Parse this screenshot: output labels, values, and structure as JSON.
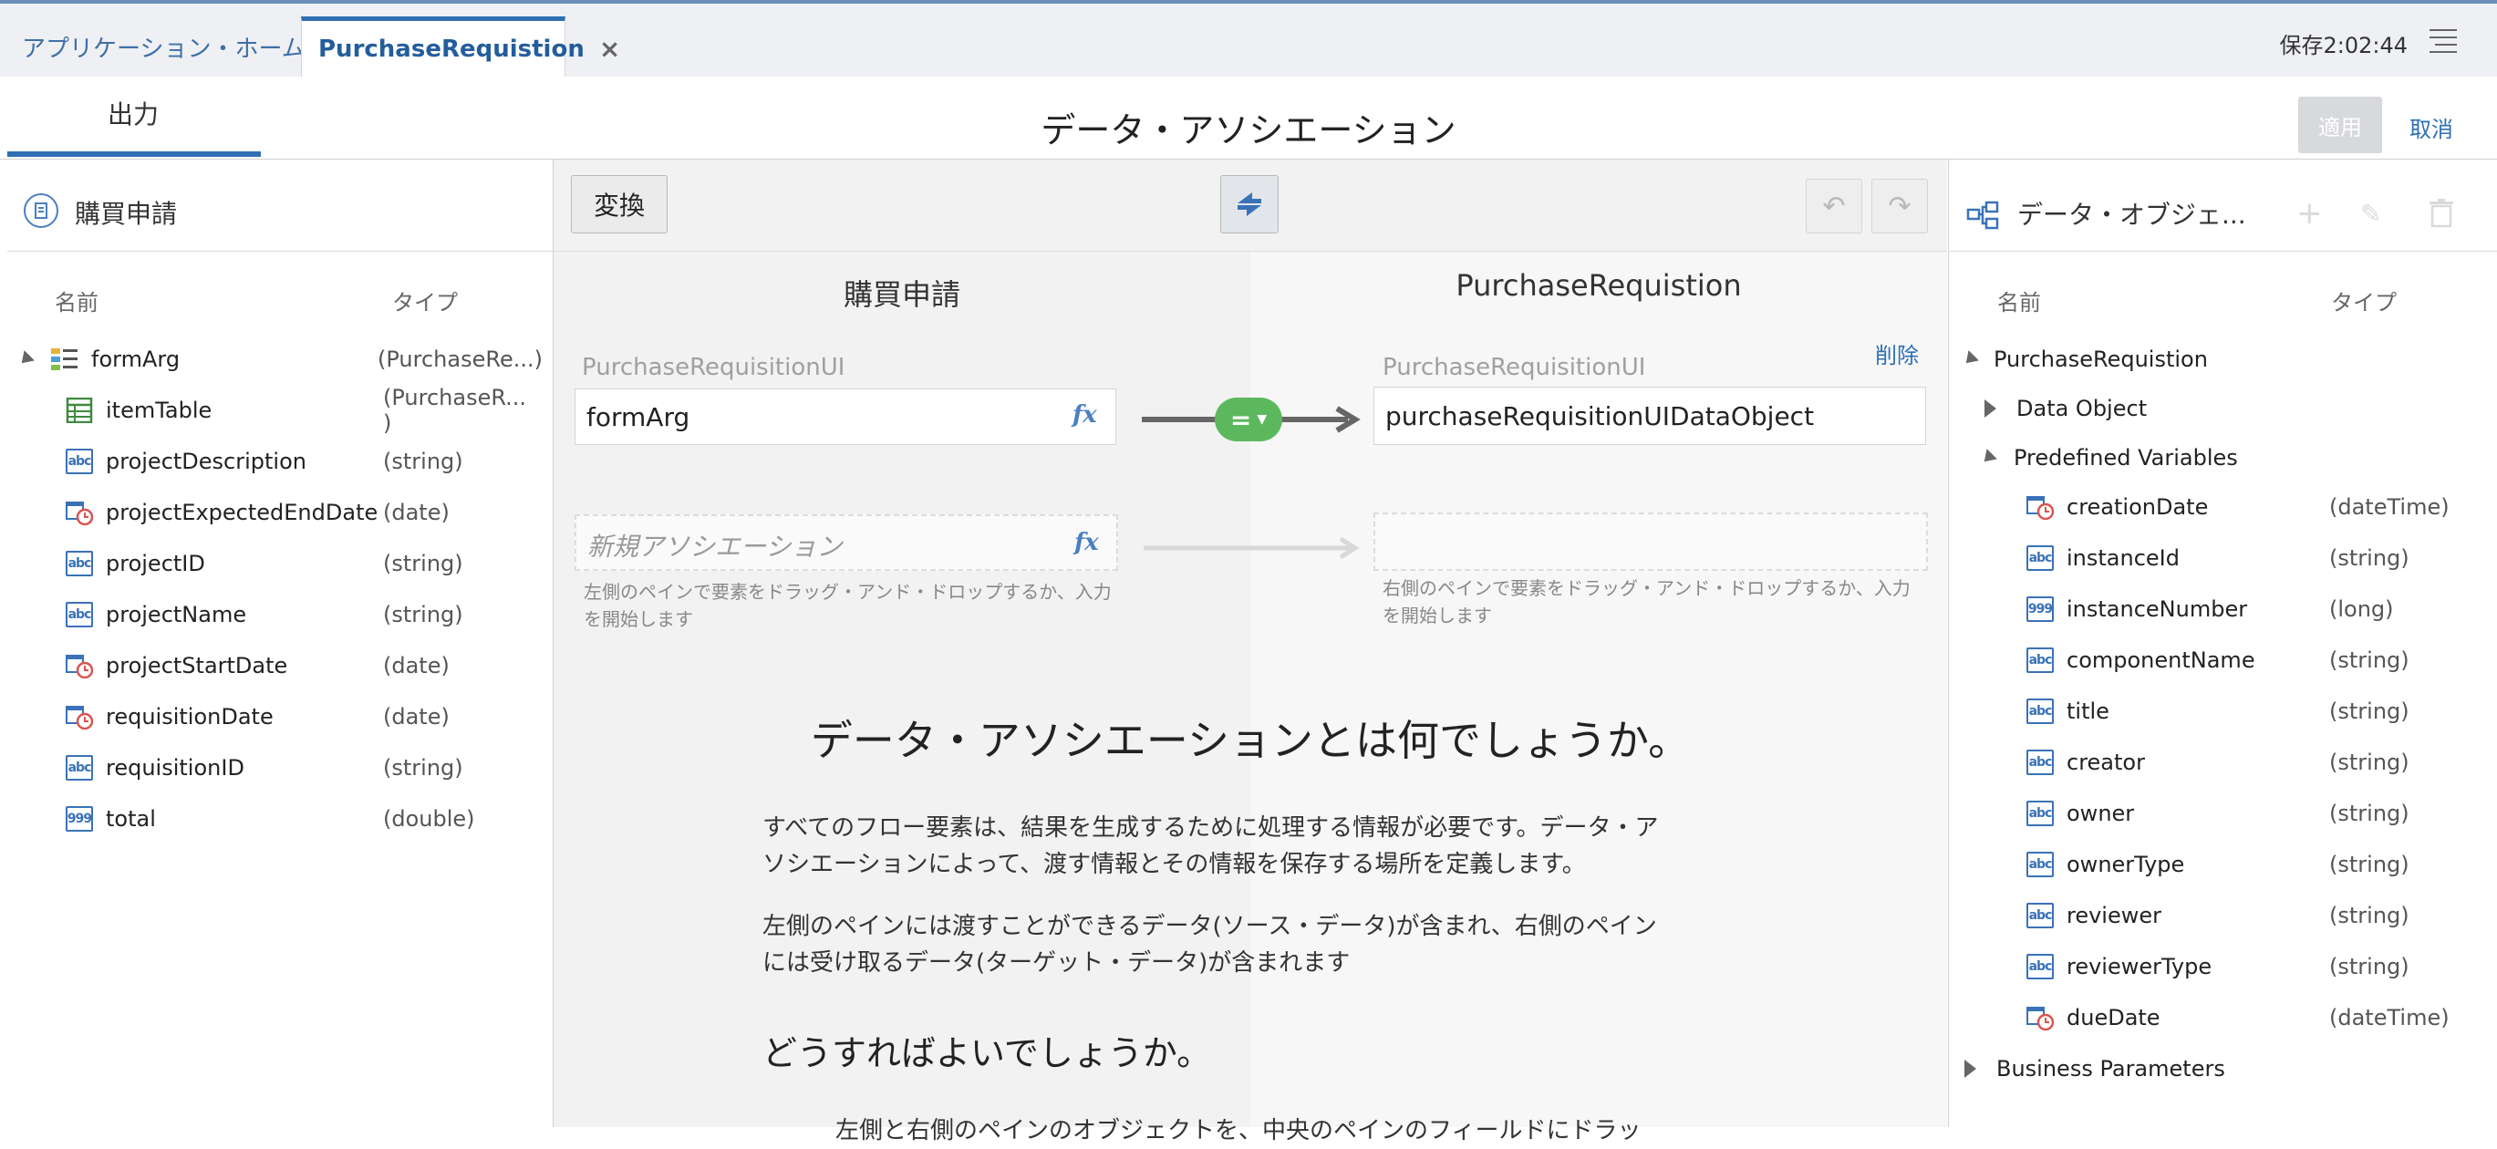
{
  "tabs": {
    "home": "アプリケーション・ホーム",
    "active": "PurchaseRequistion",
    "close": "×"
  },
  "save_status": "保存2:02:44",
  "output_tab": "出力",
  "page_title": "データ・アソシエーション",
  "buttons": {
    "apply": "適用",
    "cancel": "取消",
    "convert": "変換",
    "delete": "削除"
  },
  "left": {
    "title": "購買申請",
    "col_name": "名前",
    "col_type": "タイプ",
    "root": {
      "name": "formArg",
      "type": "(PurchaseRe...)"
    },
    "items": [
      {
        "name": "itemTable",
        "type": "(PurchaseR... )",
        "icon": "table-icon"
      },
      {
        "name": "projectDescription",
        "type": "(string)",
        "icon": "string-icon"
      },
      {
        "name": "projectExpectedEndDate",
        "type": "(date)",
        "icon": "date-icon"
      },
      {
        "name": "projectID",
        "type": "(string)",
        "icon": "string-icon"
      },
      {
        "name": "projectName",
        "type": "(string)",
        "icon": "string-icon"
      },
      {
        "name": "projectStartDate",
        "type": "(date)",
        "icon": "date-icon"
      },
      {
        "name": "requisitionDate",
        "type": "(date)",
        "icon": "date-icon"
      },
      {
        "name": "requisitionID",
        "type": "(string)",
        "icon": "string-icon"
      },
      {
        "name": "total",
        "type": "(double)",
        "icon": "number-icon"
      }
    ]
  },
  "center": {
    "source_title": "購買申請",
    "target_title": "PurchaseRequistion",
    "source_ui_label": "PurchaseRequisitionUI",
    "target_ui_label": "PurchaseRequisitionUI",
    "source_value": "formArg",
    "target_value": "purchaseRequisitionUIDataObject",
    "fx": "fx",
    "operator": "=",
    "new_association_placeholder": "新規アソシエーション",
    "hint_left": "左側のペインで要素をドラッグ・アンド・ドロップするか、入力を開始します",
    "hint_right": "右側のペインで要素をドラッグ・アンド・ドロップするか、入力を開始します",
    "help_title": "データ・アソシエーションとは何でしょうか。",
    "help_p1_line1": "すべてのフロー要素は、結果を生成するために処理する情報が必要です。データ・ア",
    "help_p1_line2": "ソシエーションによって、渡す情報とその情報を保存する場所を定義します。",
    "help_p2_line1": "左側のペインには渡すことができるデータ(ソース・データ)が含まれ、右側のペイン",
    "help_p2_line2": "には受け取るデータ(ターゲット・データ)が含まれます",
    "help_subtitle": "どうすればよいでしょうか。",
    "help_p3": "左側と右側のペインのオブジェクトを、中央のペインのフィールドにドラッ"
  },
  "right": {
    "title": "データ・オブジェ...",
    "col_name": "名前",
    "col_type": "タイプ",
    "root": "PurchaseRequistion",
    "data_object": "Data Object",
    "predefined": "Predefined Variables",
    "items": [
      {
        "name": "creationDate",
        "type": "(dateTime)",
        "icon": "date-icon"
      },
      {
        "name": "instanceId",
        "type": "(string)",
        "icon": "string-icon"
      },
      {
        "name": "instanceNumber",
        "type": "(long)",
        "icon": "number-icon"
      },
      {
        "name": "componentName",
        "type": "(string)",
        "icon": "string-icon"
      },
      {
        "name": "title",
        "type": "(string)",
        "icon": "string-icon"
      },
      {
        "name": "creator",
        "type": "(string)",
        "icon": "string-icon"
      },
      {
        "name": "owner",
        "type": "(string)",
        "icon": "string-icon"
      },
      {
        "name": "ownerType",
        "type": "(string)",
        "icon": "string-icon"
      },
      {
        "name": "reviewer",
        "type": "(string)",
        "icon": "string-icon"
      },
      {
        "name": "reviewerType",
        "type": "(string)",
        "icon": "string-icon"
      },
      {
        "name": "dueDate",
        "type": "(dateTime)",
        "icon": "date-icon"
      }
    ],
    "business_params": "Business Parameters"
  },
  "colors": {
    "accent": "#2f6fb4",
    "equals": "#5cb85c"
  }
}
